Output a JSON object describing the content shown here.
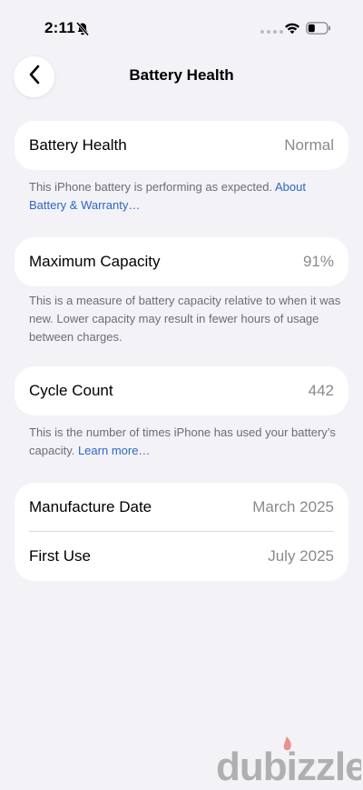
{
  "status_bar": {
    "time": "2:11",
    "icons": [
      "bell-slash-icon",
      "cellular-dots-icon",
      "wifi-icon",
      "battery-icon"
    ]
  },
  "nav": {
    "back_icon": "chevron-left-icon",
    "title": "Battery Health"
  },
  "sections": {
    "health": {
      "label": "Battery Health",
      "value": "Normal",
      "footnote": "This iPhone battery is performing as expected. ",
      "link": "About Battery & Warranty…"
    },
    "capacity": {
      "label": "Maximum Capacity",
      "value": "91%",
      "footnote": "This is a measure of battery capacity relative to when it was new. Lower capacity may result in fewer hours of usage between charges."
    },
    "cycles": {
      "label": "Cycle Count",
      "value": "442",
      "footnote": "This is the number of times iPhone has used your battery’s capacity. ",
      "link": "Learn more…"
    },
    "dates": {
      "manufacture_label": "Manufacture Date",
      "manufacture_value": "March 2025",
      "first_use_label": "First Use",
      "first_use_value": "July 2025"
    }
  },
  "watermark": {
    "text": "dubizzle",
    "accent": "#e0301e"
  },
  "colors": {
    "background": "#f2f2f7",
    "card": "#ffffff",
    "link": "#2e67c7",
    "secondary_text": "#8a8a8e"
  }
}
